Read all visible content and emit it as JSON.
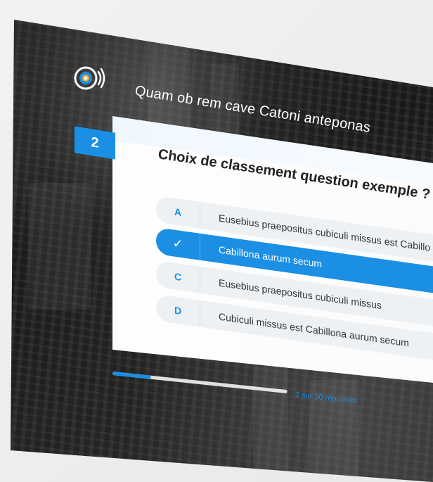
{
  "app": {
    "title": "Quam ob rem cave Catoni anteponas"
  },
  "question": {
    "number": "2",
    "text": "Choix de classement question exemple ?"
  },
  "options": [
    {
      "key": "A",
      "label": "Eusebius praepositus cubiculi missus est Cabillo",
      "selected": false
    },
    {
      "key": "✓",
      "label": "Cabillona aurum secum",
      "selected": true
    },
    {
      "key": "C",
      "label": "Eusebius praepositus cubiculi missus",
      "selected": false
    },
    {
      "key": "D",
      "label": "Cubiculi missus est Cabillona aurum secum",
      "selected": false
    }
  ],
  "progress": {
    "fraction": 0.22,
    "text": "2 sur 30 réponses"
  },
  "colors": {
    "accent": "#1a8fe3",
    "option_bg": "#eef1f4",
    "text_dark": "#222222"
  },
  "icons": {
    "logo": "broadcast-target-icon",
    "check": "check-icon"
  }
}
